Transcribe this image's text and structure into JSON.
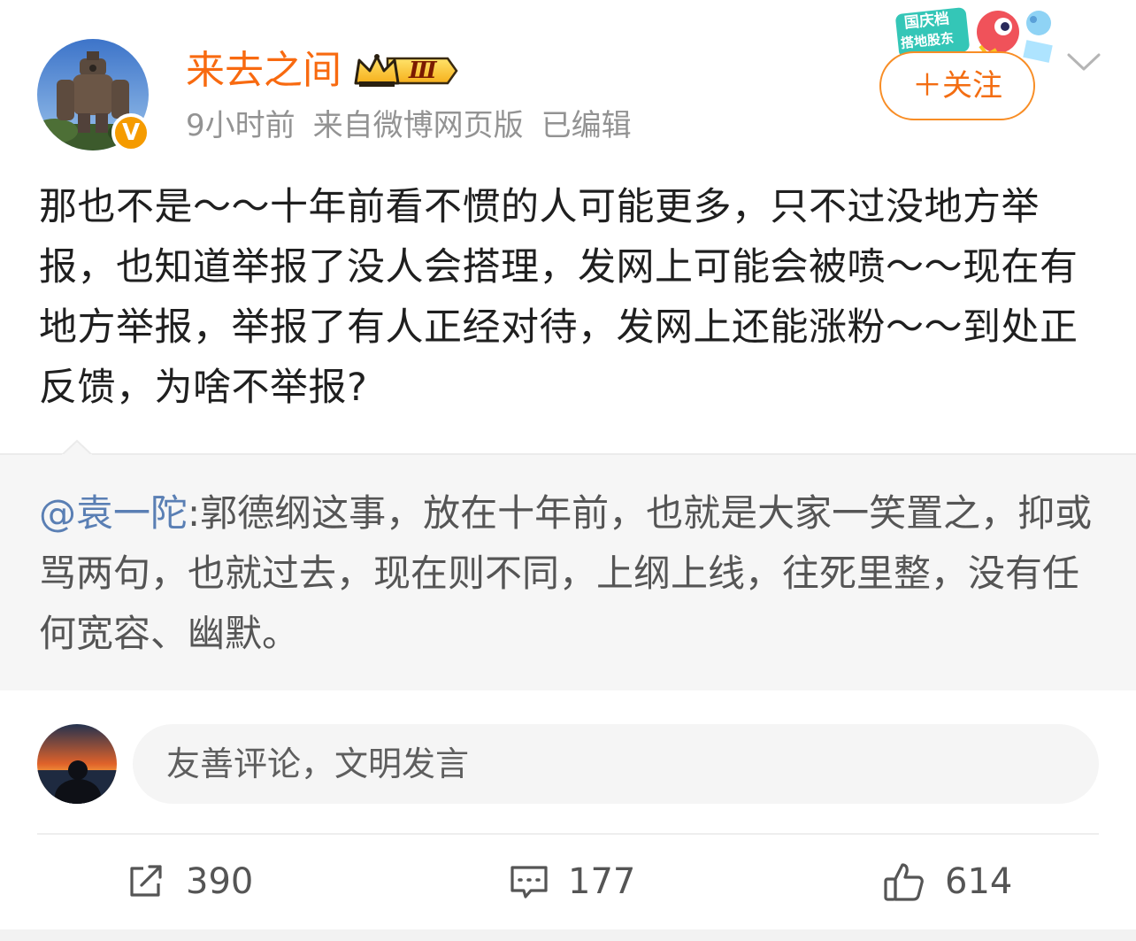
{
  "author": {
    "name": "来去之间",
    "level_badge": "Ⅲ",
    "verified_mark": "V",
    "time": "9小时前",
    "source": "来自微博网页版",
    "edited": "已编辑"
  },
  "header": {
    "follow_label": "＋关注",
    "promo_text_1": "国庆档",
    "promo_text_2": "搭地股东"
  },
  "post": {
    "text": "那也不是～～十年前看不惯的人可能更多，只不过没地方举报，也知道举报了没人会搭理，发网上可能会被喷～～现在有地方举报，举报了有人正经对待，发网上还能涨粉～～到处正反馈，为啥不举报?"
  },
  "retweet": {
    "at_user": "@袁一陀",
    "text": ":郭德纲这事，放在十年前，也就是大家一笑置之，抑或骂两句，也就过去，现在则不同，上纲上线，往死里整，没有任何宽容、幽默。"
  },
  "comment_box": {
    "placeholder": "友善评论，文明发言"
  },
  "actions": {
    "repost_count": "390",
    "comment_count": "177",
    "like_count": "614"
  },
  "colors": {
    "username": "#f86a10",
    "follow_border": "#f88d25",
    "mention": "#5a7fb4",
    "verified": "#f59b00"
  }
}
